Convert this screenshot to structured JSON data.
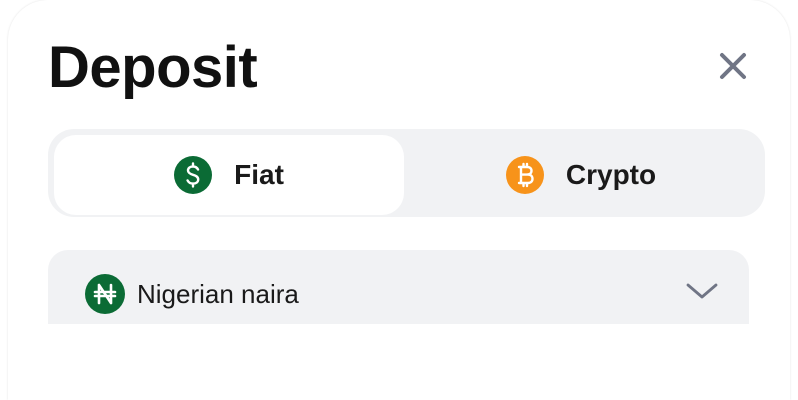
{
  "dialog": {
    "title": "Deposit",
    "close_icon": "close-icon"
  },
  "tabs": [
    {
      "label": "Fiat",
      "icon": "dollar-icon",
      "icon_glyph": "$",
      "icon_color": "#0b6b35",
      "selected": true
    },
    {
      "label": "Crypto",
      "icon": "bitcoin-icon",
      "icon_glyph": "₿",
      "icon_color": "#f7931a",
      "selected": false
    }
  ],
  "currency_select": {
    "value": "Nigerian naira",
    "icon": "naira-icon",
    "icon_glyph": "₦",
    "icon_color": "#0b6b35",
    "chevron": "chevron-down-icon"
  },
  "colors": {
    "tab_track": "#f1f2f4",
    "icon_gray": "#707585",
    "fiat_green": "#0b6b35",
    "bitcoin_orange": "#f7931a"
  }
}
